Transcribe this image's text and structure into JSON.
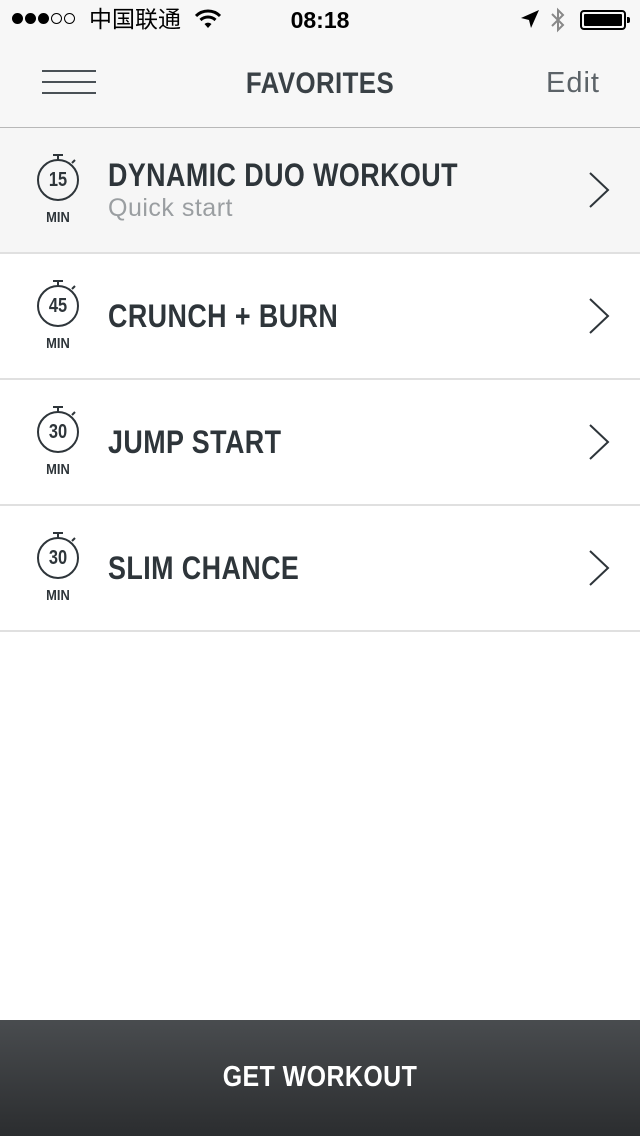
{
  "status_bar": {
    "carrier": "中国联通",
    "time": "08:18",
    "signal_bars": 3,
    "signal_total": 5
  },
  "nav": {
    "title": "FAVORITES",
    "edit_label": "Edit",
    "menu_icon": "hamburger-menu-icon"
  },
  "workouts": [
    {
      "duration": "15",
      "unit": "MIN",
      "title": "DYNAMIC DUO WORKOUT",
      "subtitle": "Quick start"
    },
    {
      "duration": "45",
      "unit": "MIN",
      "title": "CRUNCH + BURN",
      "subtitle": ""
    },
    {
      "duration": "30",
      "unit": "MIN",
      "title": "JUMP START",
      "subtitle": ""
    },
    {
      "duration": "30",
      "unit": "MIN",
      "title": "SLIM CHANCE",
      "subtitle": ""
    }
  ],
  "footer": {
    "button_label": "GET WORKOUT"
  },
  "colors": {
    "text_dark": "#2e353a",
    "subtitle": "#9a9ea1",
    "footer_bg": "#3a3c3e",
    "nav_bg": "#f7f7f7"
  }
}
